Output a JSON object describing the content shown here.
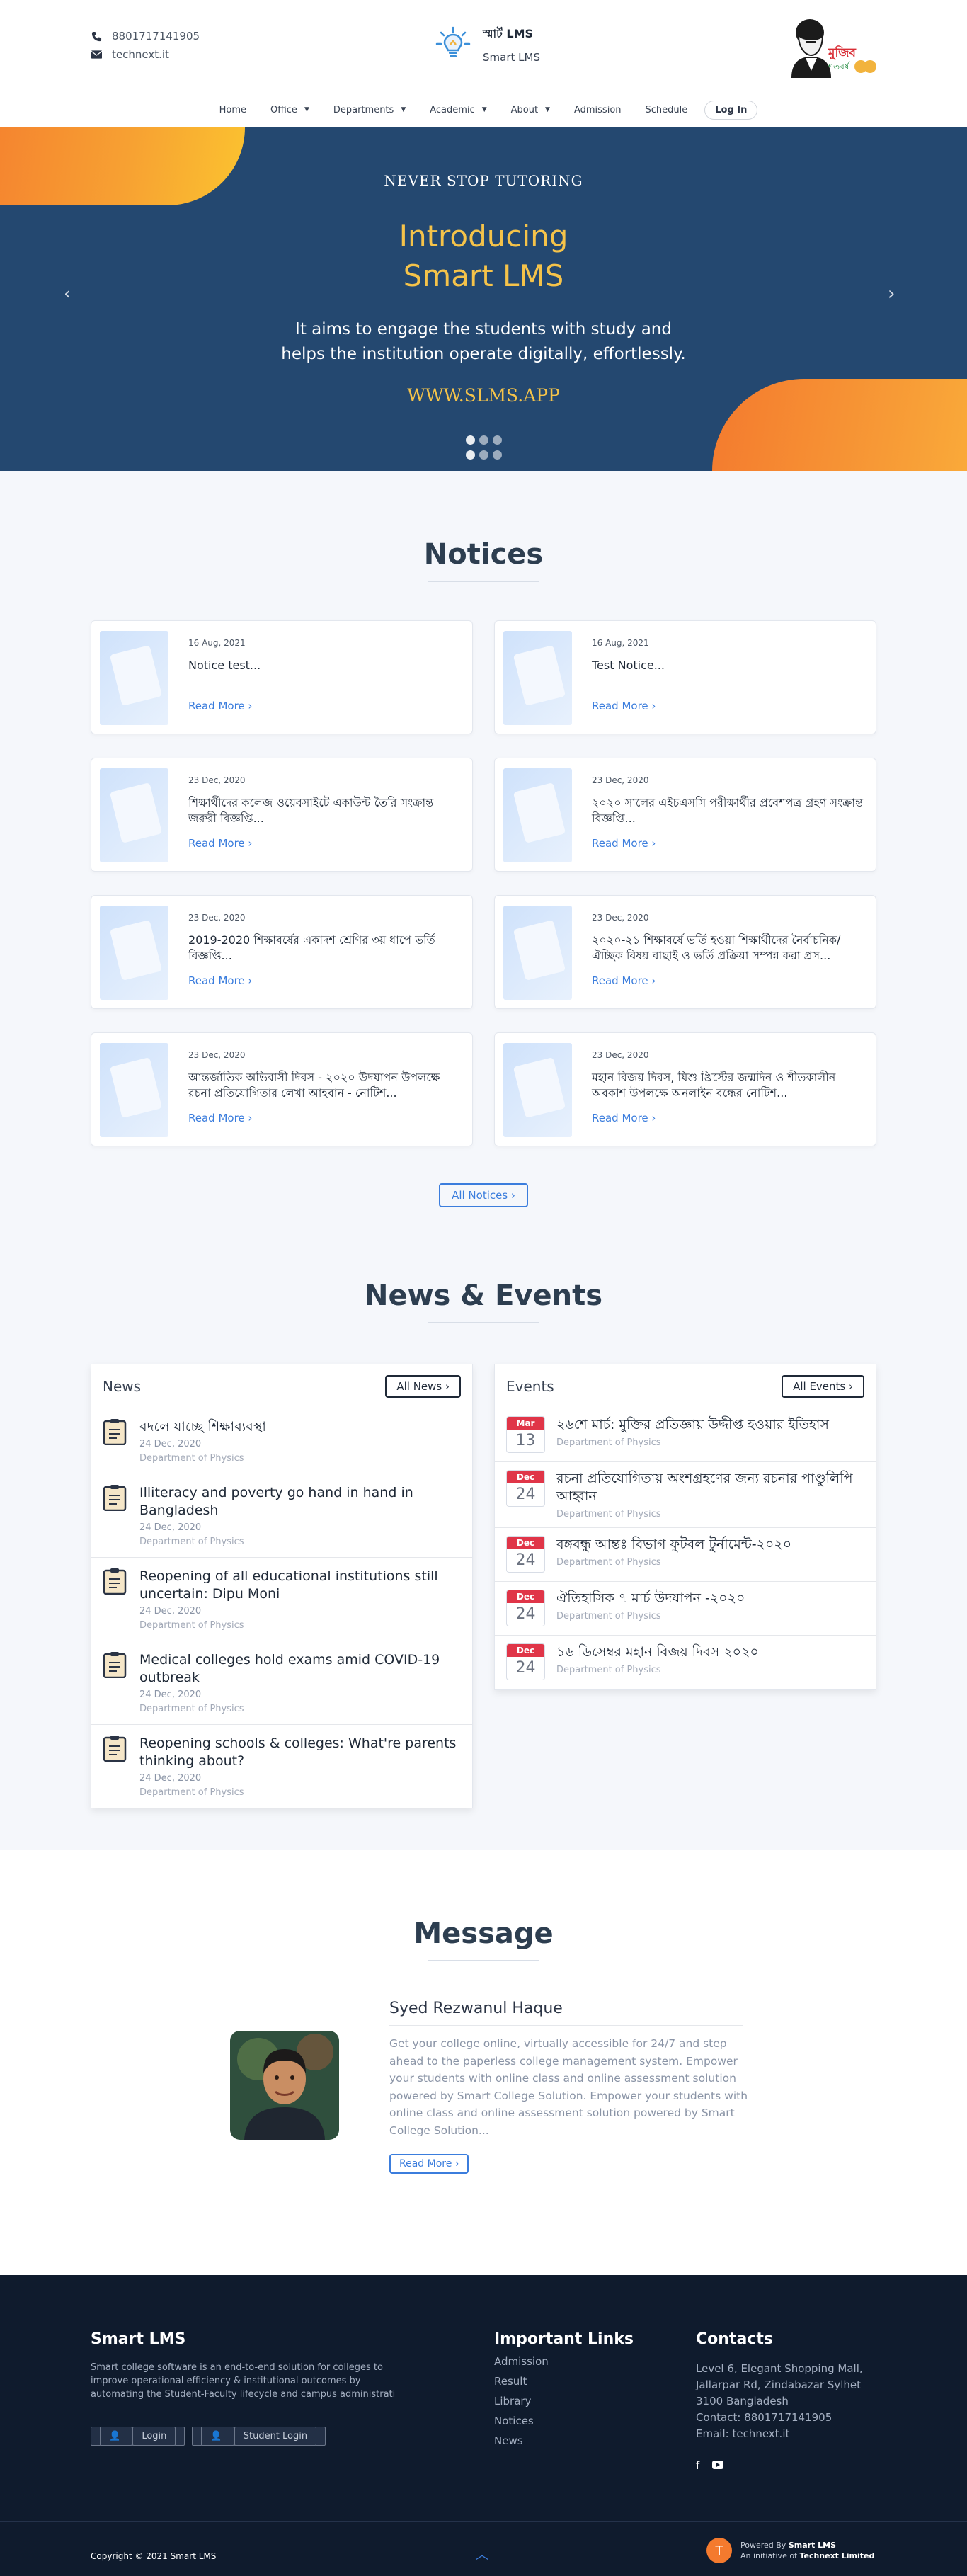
{
  "header": {
    "phone": "8801717141905",
    "email": "technext.it",
    "brand_name": "স্মার্ট LMS",
    "brand_sub": "Smart LMS",
    "mujib_text": "মুজিব শতবর্ষ",
    "mujib_years": "১০০"
  },
  "nav": {
    "items": [
      "Home",
      "Office",
      "Departments",
      "Academic",
      "About",
      "Admission",
      "Schedule"
    ],
    "login": "Log In"
  },
  "hero": {
    "kicker": "NEVER STOP TUTORING",
    "title_line1": "Introducing",
    "title_line2": "Smart LMS",
    "sub_line1": "It aims to engage the students with study and",
    "sub_line2": "helps the institution operate digitally, effortlessly.",
    "url": "WWW.SLMS.APP",
    "prev_icon": "‹",
    "next_icon": "›"
  },
  "notices": {
    "title": "Notices",
    "read_more": "Read More ›",
    "all_button": "All Notices ›",
    "items": [
      {
        "date": "16 Aug, 2021",
        "title": "Notice test..."
      },
      {
        "date": "16 Aug, 2021",
        "title": "Test Notice..."
      },
      {
        "date": "23 Dec, 2020",
        "title": "শিক্ষার্থীদের কলেজ ওয়েবসাইটে একাউন্ট তৈরি সংক্রান্ত জরুরী বিজ্ঞপ্তি..."
      },
      {
        "date": "23 Dec, 2020",
        "title": "২০২০ সালের এইচএসসি পরীক্ষার্থীর প্রবেশপত্র গ্রহণ সংক্রান্ত বিজ্ঞপ্তি..."
      },
      {
        "date": "23 Dec, 2020",
        "title": "2019-2020 শিক্ষাবর্ষের একাদশ শ্রেণির ৩য় ধাপে ভর্তি বিজ্ঞপ্তি..."
      },
      {
        "date": "23 Dec, 2020",
        "title": "২০২০-২১ শিক্ষাবর্ষে ভর্তি হওয়া শিক্ষার্থীদের নৈর্বাচনিক/ঐচ্ছিক বিষয় বাছাই ও ভর্তি প্রক্রিয়া সম্পন্ন করা প্রস..."
      },
      {
        "date": "23 Dec, 2020",
        "title": "আন্তর্জাতিক অভিবাসী দিবস - ২০২০ উদযাপন উপলক্ষে রচনা প্রতিযোগিতার লেখা আহবান - নোটিশ..."
      },
      {
        "date": "23 Dec, 2020",
        "title": "মহান বিজয় দিবস, যিশু খ্রিস্টের জন্মদিন ও শীতকালীন অবকাশ উপলক্ষে অনলাইন বন্ধের নোটিশ..."
      }
    ]
  },
  "news_events": {
    "title": "News & Events",
    "news": {
      "heading": "News",
      "all_button": "All News ›",
      "items": [
        {
          "title": "বদলে যাচ্ছে শিক্ষাব্যবস্থা",
          "date": "24 Dec, 2020",
          "dept": "Department of Physics"
        },
        {
          "title": "Illiteracy and poverty go hand in hand in Bangladesh",
          "date": "24 Dec, 2020",
          "dept": "Department of Physics"
        },
        {
          "title": "Reopening of all educational institutions still uncertain: Dipu Moni",
          "date": "24 Dec, 2020",
          "dept": "Department of Physics"
        },
        {
          "title": "Medical colleges hold exams amid COVID-19 outbreak",
          "date": "24 Dec, 2020",
          "dept": "Department of Physics"
        },
        {
          "title": "Reopening schools & colleges: What're parents thinking about?",
          "date": "24 Dec, 2020",
          "dept": "Department of Physics"
        }
      ]
    },
    "events": {
      "heading": "Events",
      "all_button": "All Events ›",
      "items": [
        {
          "month": "Mar",
          "day": "13",
          "title": "২৬শে মার্চ: মুক্তির প্রতিজ্ঞায় উদ্দীপ্ত হওয়ার ইতিহাস",
          "dept": "Department of Physics"
        },
        {
          "month": "Dec",
          "day": "24",
          "title": "রচনা প্রতিযোগিতায় অংশগ্রহণের জন্য রচনার পাণ্ডুলিপি আহ্বান",
          "dept": "Department of Physics"
        },
        {
          "month": "Dec",
          "day": "24",
          "title": "বঙ্গবন্ধু আন্তঃ বিভাগ ফুটবল টুর্নামেন্ট-২০২০",
          "dept": "Department of Physics"
        },
        {
          "month": "Dec",
          "day": "24",
          "title": "ঐতিহাসিক ৭ মার্চ উদযাপন -২০২০",
          "dept": "Department of Physics"
        },
        {
          "month": "Dec",
          "day": "24",
          "title": "১৬ ডিসেম্বর মহান বিজয় দিবস ২০২০",
          "dept": "Department of Physics"
        }
      ]
    }
  },
  "message": {
    "title": "Message",
    "name": "Syed Rezwanul Haque",
    "text": "Get your college online, virtually accessible for 24/7 and step ahead to the paperless college management system. Empower your students with online class and online assessment solution powered by Smart College Solution. Empower your students with online class and online assessment solution powered by Smart College Solution...",
    "button": "Read More ›"
  },
  "footer": {
    "about_title": "Smart LMS",
    "about_text": "Smart college software is an end-to-end solution for colleges to improve operational efficiency & institutional outcomes by automating the Student-Faculty lifecycle and campus administrati",
    "login_button": "Login",
    "student_login_button": "Student Login",
    "links_title": "Important Links",
    "links": [
      "Admission",
      "Result",
      "Library",
      "Notices",
      "News"
    ],
    "contact_title": "Contacts",
    "address_line1": "Level 6, Elegant Shopping Mall,",
    "address_line2": "Jallarpar Rd, Zindabazar Sylhet",
    "address_line3": "3100 Bangladesh",
    "contact_label": "Contact:",
    "contact_value": "8801717141905",
    "email_label": "Email:",
    "email_value": "technext.it",
    "copyright": "Copyright © 2021 Smart LMS",
    "powered_line1_a": "Powered By ",
    "powered_line1_b": "Smart LMS",
    "powered_line2_a": "An initiative of ",
    "powered_line2_b": "Technext Limited"
  },
  "colors": {
    "accent": "#3b7ddd",
    "hero_bg": "#244870",
    "hero_gold": "#f5c34a",
    "orange": "#f47a2e",
    "event_red": "#e03548",
    "footer_bg": "#0f1b2d"
  }
}
